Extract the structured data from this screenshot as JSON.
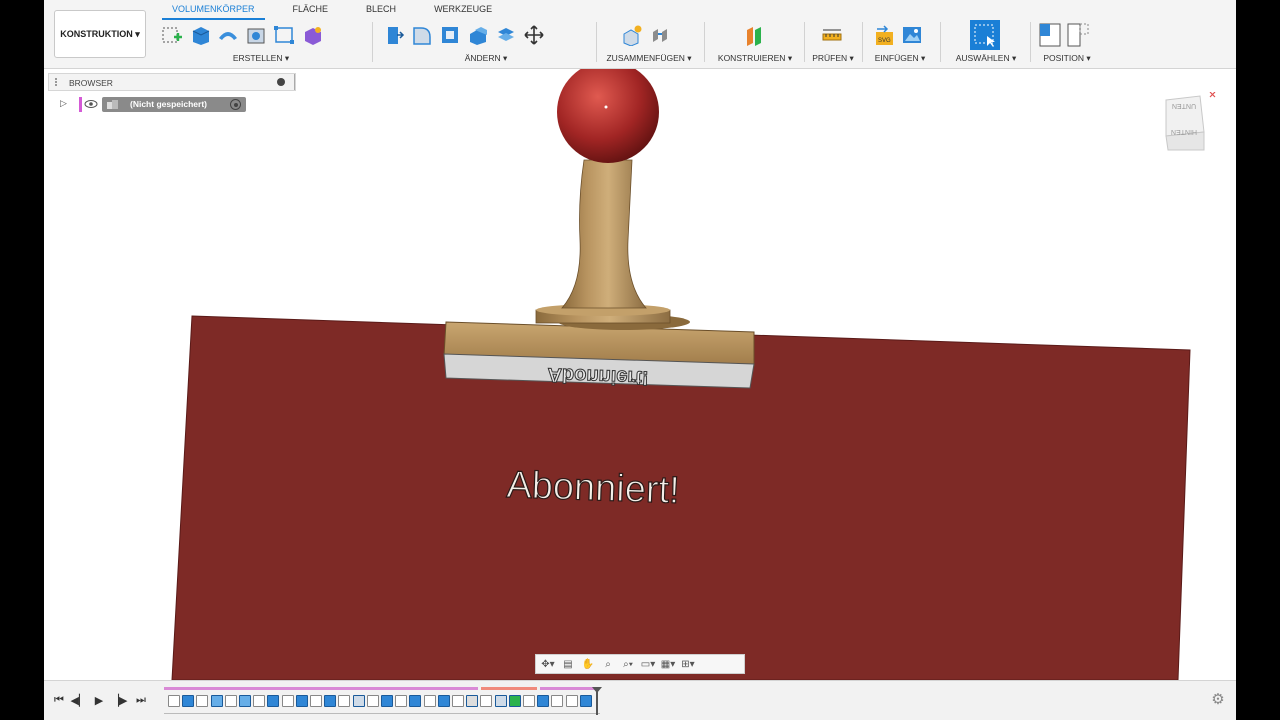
{
  "workspace": {
    "label": "KONSTRUKTION"
  },
  "tabs": [
    {
      "label": "VOLUMENKÖRPER",
      "active": true
    },
    {
      "label": "FLÄCHE",
      "active": false
    },
    {
      "label": "BLECH",
      "active": false
    },
    {
      "label": "WERKZEUGE",
      "active": false
    }
  ],
  "groups": {
    "erstellen": "ERSTELLEN",
    "aendern": "ÄNDERN",
    "zusammenfuegen": "ZUSAMMENFÜGEN",
    "konstruieren": "KONSTRUIEREN",
    "pruefen": "PRÜFEN",
    "einfuegen": "EINFÜGEN",
    "auswaehlen": "AUSWÄHLEN",
    "position": "POSITION"
  },
  "browser": {
    "title": "BROWSER",
    "document": "(Nicht gespeichert)"
  },
  "model": {
    "stamp_text": "Abonniert!",
    "imprint_text": "Abonniert!",
    "paper_color": "#7e2a26",
    "handle_color": "#a12524"
  },
  "viewcube": {
    "top_label": "UNTEN",
    "side_label": "HINTEN"
  },
  "colors": {
    "accent": "#1a7fd6",
    "timeline_pink": "#d98ad6",
    "timeline_salmon": "#f08a7c"
  }
}
